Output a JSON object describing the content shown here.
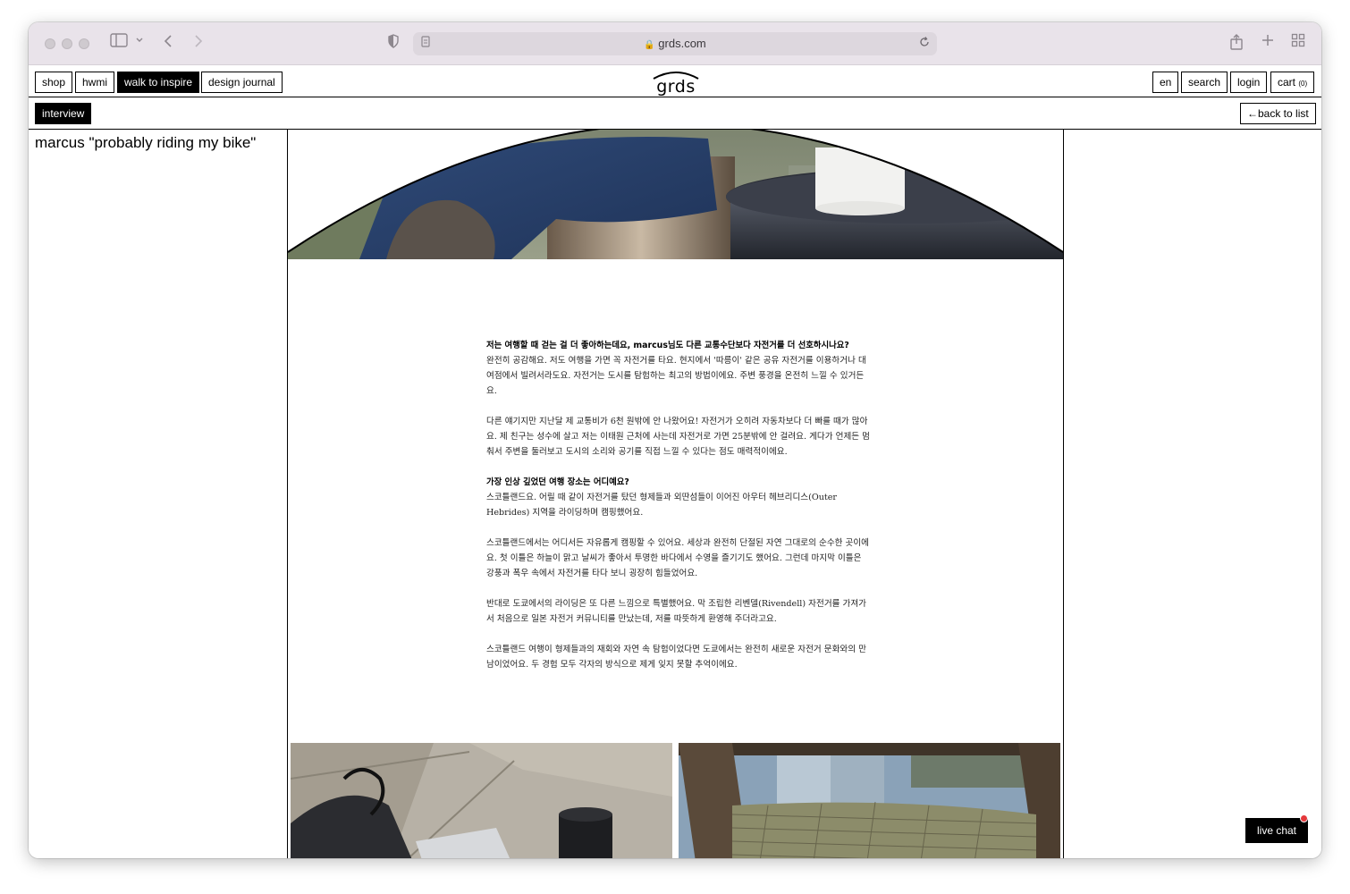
{
  "browser": {
    "url": "grds.com"
  },
  "nav": {
    "left": [
      "shop",
      "hwmi",
      "walk to inspire",
      "design journal"
    ],
    "active": "walk to inspire",
    "logo": "grds",
    "right": {
      "lang": "en",
      "search": "search",
      "login": "login",
      "cart": "cart",
      "cart_count": "(0)"
    }
  },
  "subnav": {
    "category": "interview",
    "back": "back to list"
  },
  "article": {
    "title": "marcus \"probably riding my bike\"",
    "q1": "저는 여행할 때 걷는 걸 더 좋아하는데요, marcus님도 다른 교통수단보다 자전거를 더 선호하시나요?",
    "a1": "완전히 공감해요. 저도 여행을 가면 꼭 자전거를 타요. 현지에서 '따릉이' 같은 공유 자전거를 이용하거나 대여점에서 빌려서라도요. 자전거는 도시를 탐험하는 최고의 방법이에요. 주변 풍경을 온전히 느낄 수 있거든요.",
    "a1b": "다른 얘기지만 지난달 제 교통비가 6천 원밖에 안 나왔어요! 자전거가 오히려 자동차보다 더 빠를 때가 많아요. 제 친구는 성수에 살고 저는 이태원 근처에 사는데 자전거로 가면 25분밖에 안 걸려요. 게다가 언제든 멈춰서 주변을 둘러보고 도시의 소리와 공기를 직접 느낄 수 있다는 점도 매력적이에요.",
    "q2": "가장 인상 깊었던 여행 장소는 어디예요?",
    "a2": "스코틀랜드요. 어릴 때 같이 자전거를 탔던 형제들과 외딴섬들이 이어진 아우터 헤브리디스(Outer Hebrides) 지역을 라이딩하며 캠핑했어요.",
    "a2b": "스코틀랜드에서는 어디서든 자유롭게 캠핑할 수 있어요. 세상과 완전히 단절된 자연 그대로의 순수한 곳이에요. 첫 이틀은 하늘이 맑고 날씨가 좋아서 투명한 바다에서 수영을 즐기기도 했어요. 그런데 마지막 이틀은 강풍과 폭우 속에서 자전거를 타다 보니 굉장히 힘들었어요.",
    "a2c": "반대로 도쿄에서의 라이딩은 또 다른 느낌으로 특별했어요. 막 조립한 리벤델(Rivendell) 자전거를 가져가서 처음으로 일본 자전거 커뮤니티를 만났는데, 저를 따뜻하게 환영해 주더라고요.",
    "a2d": "스코틀랜드 여행이 형제들과의 재회와 자연 속 탐험이었다면 도쿄에서는 완전히 새로운 자전거 문화와의 만남이었어요. 두 경험 모두 각자의 방식으로 제게 잊지 못할 추억이에요."
  },
  "chat": {
    "label": "live chat"
  },
  "colors": {
    "accent": "#000000",
    "chrome": "#e9e3ea",
    "notification": "#e5383b"
  },
  "icons": [
    "sidebar-icon",
    "chevron-down-icon",
    "back-arrow-icon",
    "forward-arrow-icon",
    "shield-icon",
    "page-icon",
    "lock-icon",
    "reload-icon",
    "share-icon",
    "plus-icon",
    "tabs-grid-icon",
    "left-arrow-icon"
  ]
}
